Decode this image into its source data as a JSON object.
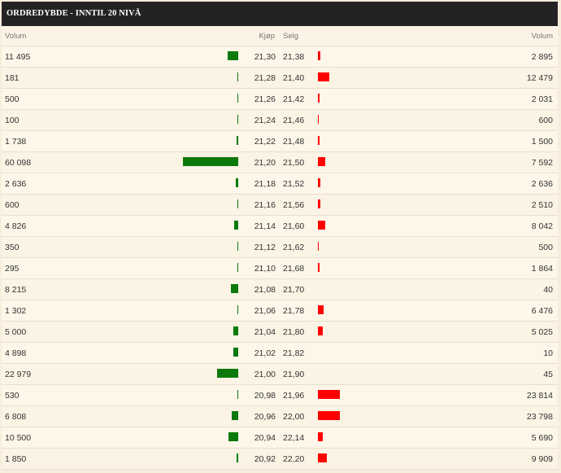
{
  "title": "ORDREDYBDE - INNTIL 20 NIVÅ",
  "headers": {
    "buy_volume": "Volum",
    "buy_price": "Kjøp",
    "sell_price": "Selg",
    "sell_volume": "Volum"
  },
  "colors": {
    "buy": "#0b7a0b",
    "sell": "#ff0000"
  },
  "rows": [
    {
      "buy_volume": "11 495",
      "buy_volume_n": 11495,
      "buy_price": "21,30",
      "sell_price": "21,38",
      "sell_volume": "2 895",
      "sell_volume_n": 2895
    },
    {
      "buy_volume": "181",
      "buy_volume_n": 181,
      "buy_price": "21,28",
      "sell_price": "21,40",
      "sell_volume": "12 479",
      "sell_volume_n": 12479
    },
    {
      "buy_volume": "500",
      "buy_volume_n": 500,
      "buy_price": "21,26",
      "sell_price": "21,42",
      "sell_volume": "2 031",
      "sell_volume_n": 2031
    },
    {
      "buy_volume": "100",
      "buy_volume_n": 100,
      "buy_price": "21,24",
      "sell_price": "21,46",
      "sell_volume": "600",
      "sell_volume_n": 600
    },
    {
      "buy_volume": "1 738",
      "buy_volume_n": 1738,
      "buy_price": "21,22",
      "sell_price": "21,48",
      "sell_volume": "1 500",
      "sell_volume_n": 1500
    },
    {
      "buy_volume": "60 098",
      "buy_volume_n": 60098,
      "buy_price": "21,20",
      "sell_price": "21,50",
      "sell_volume": "7 592",
      "sell_volume_n": 7592
    },
    {
      "buy_volume": "2 636",
      "buy_volume_n": 2636,
      "buy_price": "21,18",
      "sell_price": "21,52",
      "sell_volume": "2 636",
      "sell_volume_n": 2636
    },
    {
      "buy_volume": "600",
      "buy_volume_n": 600,
      "buy_price": "21,16",
      "sell_price": "21,56",
      "sell_volume": "2 510",
      "sell_volume_n": 2510
    },
    {
      "buy_volume": "4 826",
      "buy_volume_n": 4826,
      "buy_price": "21,14",
      "sell_price": "21,60",
      "sell_volume": "8 042",
      "sell_volume_n": 8042
    },
    {
      "buy_volume": "350",
      "buy_volume_n": 350,
      "buy_price": "21,12",
      "sell_price": "21,62",
      "sell_volume": "500",
      "sell_volume_n": 500
    },
    {
      "buy_volume": "295",
      "buy_volume_n": 295,
      "buy_price": "21,10",
      "sell_price": "21,68",
      "sell_volume": "1 864",
      "sell_volume_n": 1864
    },
    {
      "buy_volume": "8 215",
      "buy_volume_n": 8215,
      "buy_price": "21,08",
      "sell_price": "21,70",
      "sell_volume": "40",
      "sell_volume_n": 40
    },
    {
      "buy_volume": "1 302",
      "buy_volume_n": 1302,
      "buy_price": "21,06",
      "sell_price": "21,78",
      "sell_volume": "6 476",
      "sell_volume_n": 6476
    },
    {
      "buy_volume": "5 000",
      "buy_volume_n": 5000,
      "buy_price": "21,04",
      "sell_price": "21,80",
      "sell_volume": "5 025",
      "sell_volume_n": 5025
    },
    {
      "buy_volume": "4 898",
      "buy_volume_n": 4898,
      "buy_price": "21,02",
      "sell_price": "21,82",
      "sell_volume": "10",
      "sell_volume_n": 10
    },
    {
      "buy_volume": "22 979",
      "buy_volume_n": 22979,
      "buy_price": "21,00",
      "sell_price": "21,90",
      "sell_volume": "45",
      "sell_volume_n": 45
    },
    {
      "buy_volume": "530",
      "buy_volume_n": 530,
      "buy_price": "20,98",
      "sell_price": "21,96",
      "sell_volume": "23 814",
      "sell_volume_n": 23814
    },
    {
      "buy_volume": "6 808",
      "buy_volume_n": 6808,
      "buy_price": "20,96",
      "sell_price": "22,00",
      "sell_volume": "23 798",
      "sell_volume_n": 23798
    },
    {
      "buy_volume": "10 500",
      "buy_volume_n": 10500,
      "buy_price": "20,94",
      "sell_price": "22,14",
      "sell_volume": "5 690",
      "sell_volume_n": 5690
    },
    {
      "buy_volume": "1 850",
      "buy_volume_n": 1850,
      "buy_price": "20,92",
      "sell_price": "22,20",
      "sell_volume": "9 909",
      "sell_volume_n": 9909
    }
  ]
}
